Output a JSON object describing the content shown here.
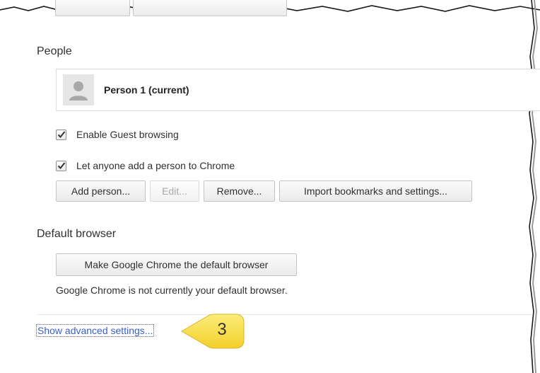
{
  "people": {
    "title": "People",
    "person_name": "Person 1 (current)",
    "enable_guest_label": "Enable Guest browsing",
    "enable_guest_checked": true,
    "let_anyone_label": "Let anyone add a person to Chrome",
    "let_anyone_checked": true,
    "buttons": {
      "add": "Add person...",
      "edit": "Edit...",
      "remove": "Remove...",
      "import": "Import bookmarks and settings..."
    }
  },
  "default_browser": {
    "title": "Default browser",
    "make_default_label": "Make Google Chrome the default browser",
    "status_text": "Google Chrome is not currently your default browser."
  },
  "advanced": {
    "link_text": "Show advanced settings..."
  },
  "callout": {
    "number": "3",
    "color": "#f7e048"
  },
  "colors": {
    "link": "#3a5ec2",
    "border": "#c4c4c4"
  }
}
